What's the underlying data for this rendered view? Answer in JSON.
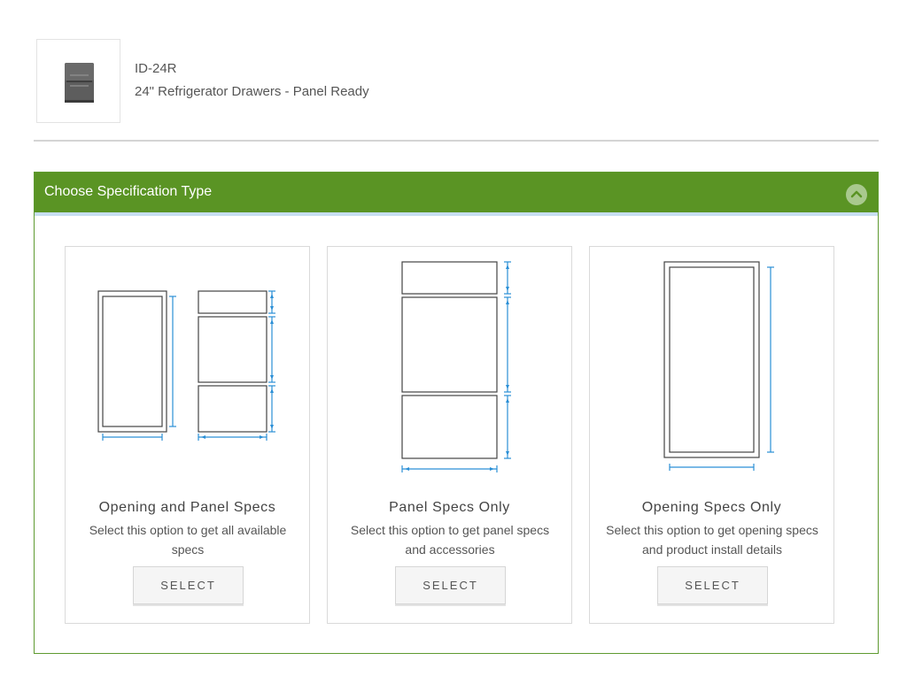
{
  "product": {
    "model": "ID-24R",
    "name": "24\" Refrigerator Drawers - Panel Ready"
  },
  "panel": {
    "title": "Choose Specification Type",
    "collapse_icon": "chevron-up-icon"
  },
  "cards": [
    {
      "title": "Opening and Panel Specs",
      "description": "Select this option to get all available specs",
      "button_label": "SELECT"
    },
    {
      "title": "Panel Specs Only",
      "description": "Select this option to get panel specs and accessories",
      "button_label": "SELECT"
    },
    {
      "title": "Opening Specs Only",
      "description": "Select this option to get opening specs and product install details",
      "button_label": "SELECT"
    }
  ],
  "colors": {
    "header_green": "#5a9424",
    "dimension_blue": "#2a8fd6",
    "outline": "#444444"
  }
}
